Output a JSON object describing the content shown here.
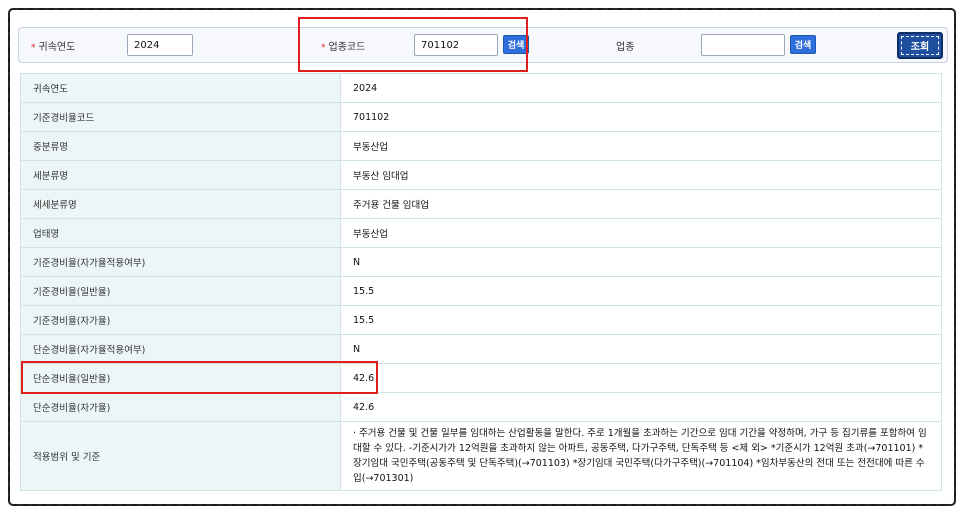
{
  "search": {
    "year_label": "귀속연도",
    "year_value": "2024",
    "code_label": "업종코드",
    "code_value": "701102",
    "search_label": "검색",
    "industry_label": "업종",
    "industry_value": "",
    "query_label": "조회"
  },
  "colors": {
    "accent": "#2f6fdc",
    "highlight": "#e01e1e",
    "label_bg": "#edf6f7"
  },
  "rows": [
    {
      "label": "귀속연도",
      "value": "2024"
    },
    {
      "label": "기준경비율코드",
      "value": "701102"
    },
    {
      "label": "중분류명",
      "value": "부동산업"
    },
    {
      "label": "세분류명",
      "value": "부동산 임대업"
    },
    {
      "label": "세세분류명",
      "value": "주거용 건물 임대업"
    },
    {
      "label": "업태명",
      "value": "부동산업"
    },
    {
      "label": "기준경비율(자가율적용여부)",
      "value": "N"
    },
    {
      "label": "기준경비율(일반율)",
      "value": "15.5"
    },
    {
      "label": "기준경비율(자가율)",
      "value": "15.5"
    },
    {
      "label": "단순경비율(자가율적용여부)",
      "value": "N"
    },
    {
      "label": "단순경비율(일반율)",
      "value": "42.6"
    },
    {
      "label": "단순경비율(자가율)",
      "value": "42.6"
    },
    {
      "label": "적용범위 및 기준",
      "value": "· 주거용 건물 및 건물 일부를 임대하는 산업활동을 말한다. 주로 1개월을 초과하는 기간으로 임대 기간을 약정하며, 가구 등 집기류를 포함하여 임대할 수 있다. -기준시가가 12억원을 초과하지 않는 아파트, 공동주택, 다가구주택, 단독주택 등 <제 외> *기준시가 12억원 초과(→701101) *장기임대 국민주택(공동주택 및 단독주택)(→701103) *장기임대 국민주택(다가구주택)(→701104) *임차부동산의 전대 또는 전전대에 따른 수입(→701301)"
    }
  ]
}
